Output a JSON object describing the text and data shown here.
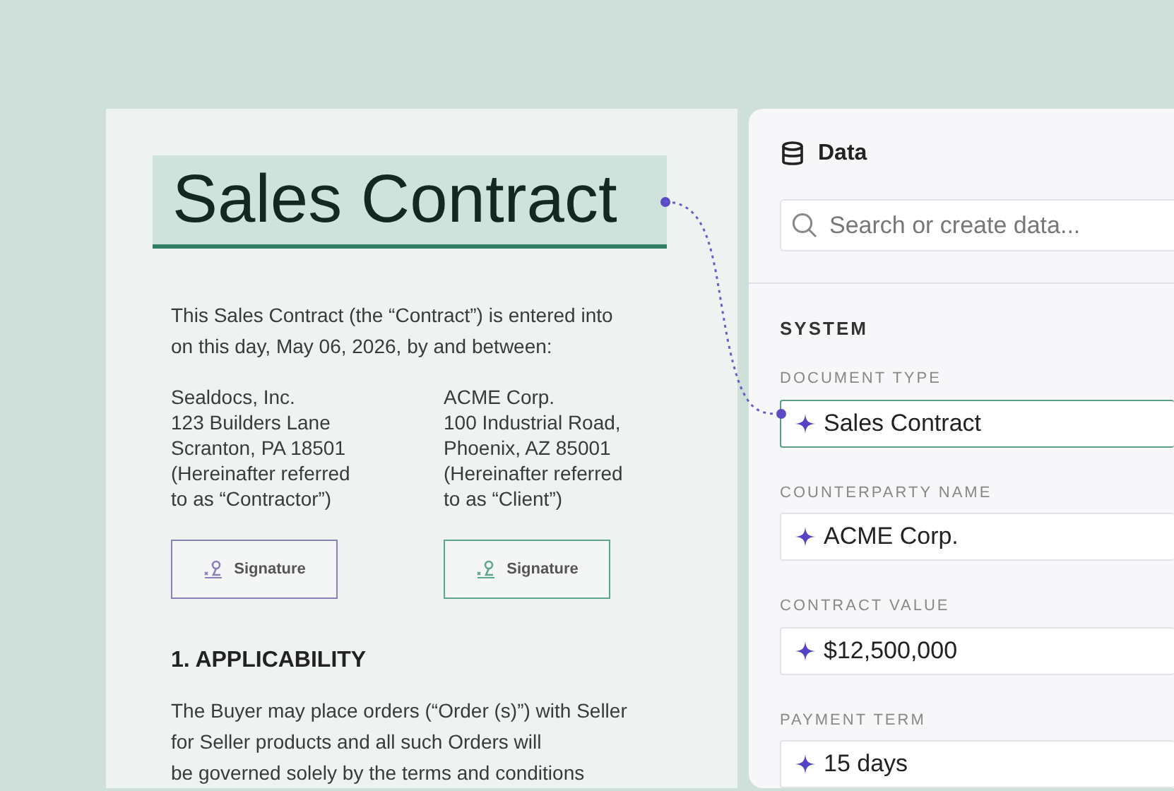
{
  "document": {
    "title": "Sales Contract",
    "intro": "This Sales Contract (the “Contract”) is entered into on this day, May 06, 2026, by and between:",
    "parties": [
      {
        "lines": [
          "Sealdocs, Inc.",
          "123 Builders Lane",
          "Scranton, PA 18501",
          "(Hereinafter referred",
          "to as “Contractor”)"
        ]
      },
      {
        "lines": [
          "ACME Corp.",
          "100 Industrial Road,",
          "Phoenix, AZ 85001",
          "(Hereinafter referred",
          "to as “Client”)"
        ]
      }
    ],
    "signatures": [
      {
        "label": "Signature",
        "color": "#8a7fb8"
      },
      {
        "label": "Signature",
        "color": "#5fa58a"
      }
    ],
    "section_heading": "1. APPLICABILITY",
    "section_body": [
      "The Buyer may place orders (“Order (s)”) with Seller",
      "for Seller products and all such Orders will",
      "be governed solely by the terms and conditions"
    ]
  },
  "data_panel": {
    "title": "Data",
    "search": {
      "placeholder": "Search or create data..."
    },
    "group": "SYSTEM",
    "fields": [
      {
        "label": "DOCUMENT TYPE",
        "value": "Sales Contract",
        "selected": true
      },
      {
        "label": "COUNTERPARTY NAME",
        "value": "ACME Corp.",
        "selected": false
      },
      {
        "label": "CONTRACT VALUE",
        "value": "$12,500,000",
        "selected": false
      },
      {
        "label": "PAYMENT TERM",
        "value": "15 days",
        "selected": false
      }
    ]
  }
}
